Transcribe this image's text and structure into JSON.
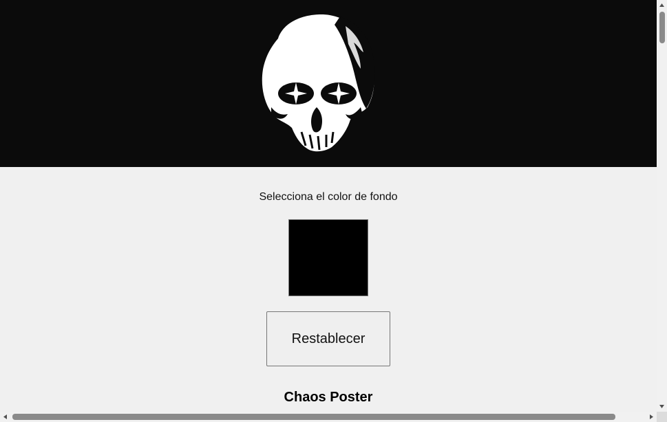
{
  "header": {
    "image": "skull-illustration"
  },
  "picker": {
    "label": "Selecciona el color de fondo",
    "value": "#000000"
  },
  "reset_button": {
    "label": "Restablecer"
  },
  "poster": {
    "title": "Chaos Poster"
  },
  "colors": {
    "header_bg": "#0b0b0b",
    "page_bg": "#f0f0f0",
    "swatch": "#000000"
  },
  "icons": {
    "scroll_up": "arrow-up-icon",
    "scroll_down": "arrow-down-icon",
    "scroll_left": "arrow-left-icon",
    "scroll_right": "arrow-right-icon"
  }
}
